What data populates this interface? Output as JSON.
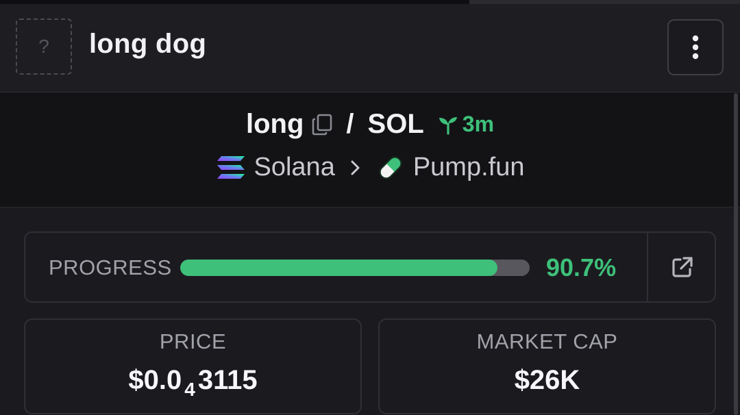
{
  "header": {
    "avatar_placeholder": "?",
    "token_name": "long dog"
  },
  "pair": {
    "base": "long",
    "quote": "SOL",
    "separator": "/",
    "age": "3m",
    "chain": "Solana",
    "dex": "Pump.fun"
  },
  "progress": {
    "label": "PROGRESS",
    "percent_text": "90.7%",
    "percent_value": 90.7
  },
  "stats": {
    "price": {
      "label": "PRICE",
      "prefix": "$0.0",
      "zeros": "4",
      "digits": "3115"
    },
    "market_cap": {
      "label": "MARKET CAP",
      "value": "$26K"
    }
  },
  "colors": {
    "accent_green": "#3ec07a",
    "background": "#1b1b1f",
    "pair_bar": "#131316"
  },
  "icons": [
    "more-vertical-icon",
    "copy-icon",
    "sprout-icon",
    "solana-logo-icon",
    "chevron-right-icon",
    "pill-icon",
    "external-link-icon"
  ]
}
